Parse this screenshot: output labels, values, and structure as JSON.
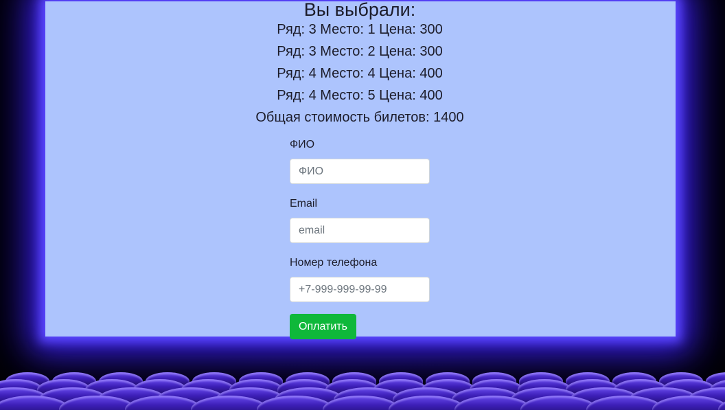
{
  "summary": {
    "title": "Вы выбрали:",
    "tickets": [
      "Ряд: 3 Место: 1 Цена: 300",
      "Ряд: 3 Место: 2 Цена: 300",
      "Ряд: 4 Место: 4 Цена: 400",
      "Ряд: 4 Место: 5 Цена: 400"
    ],
    "total": "Общая стоимость билетов: 1400"
  },
  "form": {
    "name_label": "ФИО",
    "name_placeholder": "ФИО",
    "email_label": "Email",
    "email_placeholder": "email",
    "phone_label": "Номер телефона",
    "phone_placeholder": "+7-999-999-99-99",
    "submit_label": "Оплатить"
  },
  "colors": {
    "screen": "#adc4fd",
    "screen_glow": "#5b47ff",
    "pay_button": "#0fb83a",
    "seats": "#4a2ed0"
  }
}
